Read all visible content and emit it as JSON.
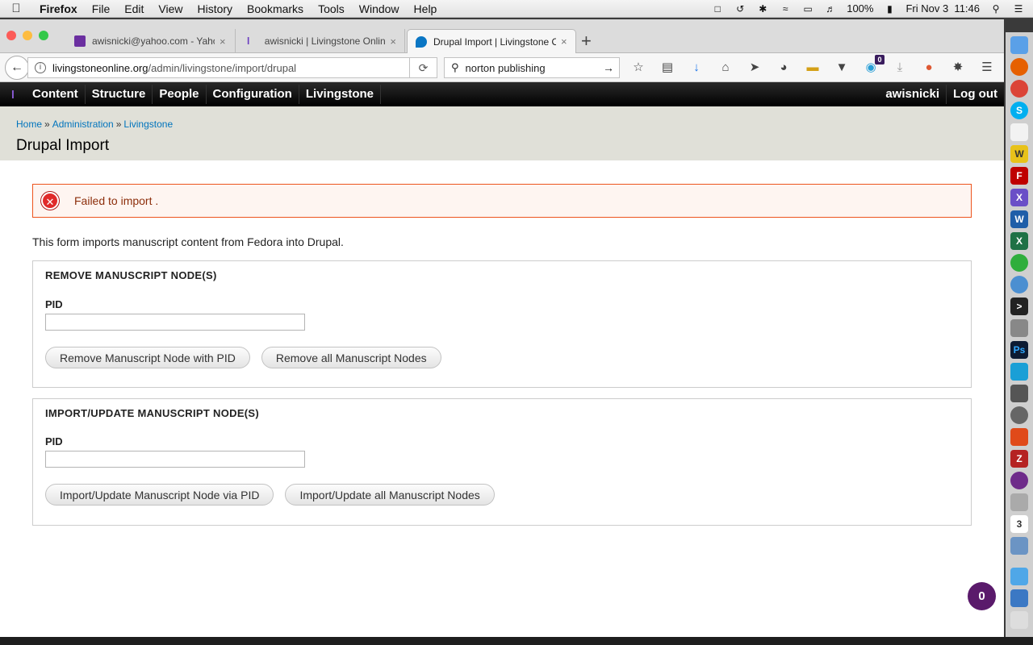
{
  "menubar": {
    "app": "Firefox",
    "items": [
      "File",
      "Edit",
      "View",
      "History",
      "Bookmarks",
      "Tools",
      "Window",
      "Help"
    ],
    "battery": "100%",
    "clock": "Fri Nov 3  11:46"
  },
  "tabs": [
    {
      "title": "awisnicki@yahoo.com - Yaho",
      "icon": "mail-icon"
    },
    {
      "title": "awisnicki | Livingstone Online",
      "icon": "livingstone-icon"
    },
    {
      "title": "Drupal Import | Livingstone O",
      "icon": "drupal-icon"
    }
  ],
  "nav": {
    "url_domain": "livingstoneonline.org",
    "url_path": "/admin/livingstone/import/drupal",
    "search_value": "norton publishing",
    "badge_count": "0"
  },
  "toolbar": {
    "items": [
      "Content",
      "Structure",
      "People",
      "Configuration",
      "Livingstone"
    ],
    "user": "awisnicki",
    "logout": "Log out"
  },
  "breadcrumb": [
    "Home",
    "Administration",
    "Livingstone"
  ],
  "page_title": "Drupal Import",
  "error_message": "Failed to import .",
  "intro_text": "This form imports manuscript content from Fedora into Drupal.",
  "remove_section": {
    "legend": "REMOVE MANUSCRIPT NODE(S)",
    "pid_label": "PID",
    "pid_value": "",
    "button1": "Remove Manuscript Node with PID",
    "button2": "Remove all Manuscript Nodes"
  },
  "import_section": {
    "legend": "IMPORT/UPDATE MANUSCRIPT NODE(S)",
    "pid_label": "PID",
    "pid_value": "",
    "button1": "Import/Update Manuscript Node via PID",
    "button2": "Import/Update all Manuscript Nodes"
  },
  "chat_count": "0"
}
